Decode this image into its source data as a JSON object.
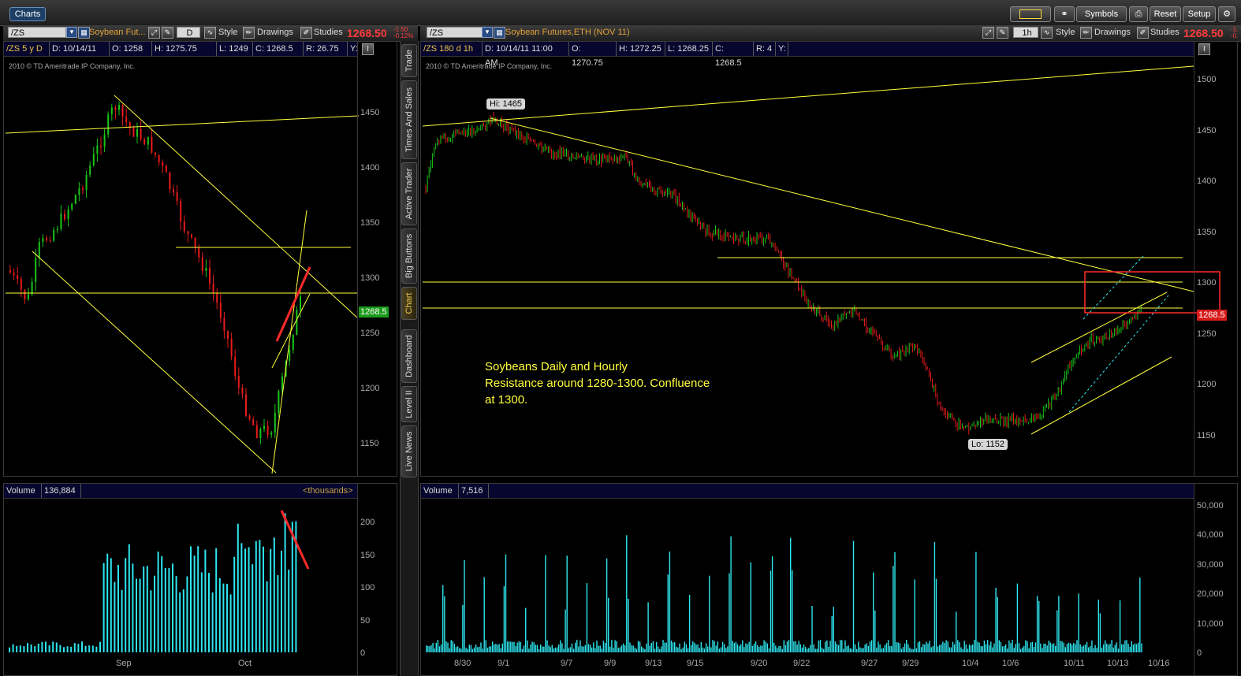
{
  "topbar": {
    "tab": "Charts",
    "symbols_label": "Symbols",
    "reset_label": "Reset",
    "setup_label": "Setup"
  },
  "left_chart": {
    "symbol": "/ZS",
    "description": "Soybean Fut...",
    "interval": "D",
    "style_label": "Style",
    "drawings_label": "Drawings",
    "studies_label": "Studies",
    "last_price": "1268.50",
    "change": "-1.50",
    "change_pct": "-0.12%",
    "info": {
      "title": "/ZS 5 y D",
      "date": "D: 10/14/11",
      "open": "O: 1258",
      "high": "H: 1275.75",
      "low": "L: 1249",
      "close": "C: 1268.5",
      "range": "R: 26.75",
      "y": "Y:"
    },
    "copyright": "2010 © TD Ameritrade IP Company, Inc.",
    "price_axis": [
      "1450",
      "1400",
      "1350",
      "1300",
      "1250",
      "1200",
      "1150"
    ],
    "current_price_tag": "1268.5",
    "volume_label": "Volume",
    "volume_value": "136,884",
    "volume_units": "<thousands>",
    "volume_axis": [
      "200",
      "150",
      "100",
      "50",
      "0"
    ],
    "date_axis": [
      "Sep",
      "Oct"
    ]
  },
  "right_chart": {
    "symbol": "/ZS",
    "description": "Soybean Futures,ETH (NOV 11)",
    "interval": "1h",
    "style_label": "Style",
    "drawings_label": "Drawings",
    "studies_label": "Studies",
    "last_price": "1268.50",
    "change": "-1.",
    "change_pct": "-0.",
    "info": {
      "title": "/ZS 180 d 1h",
      "date": "D: 10/14/11 11:00 AM",
      "open": "O: 1270.75",
      "high": "H: 1272.25",
      "low": "L: 1268.25",
      "close": "C: 1268.5",
      "range": "R: 4",
      "y": "Y:"
    },
    "copyright": "2010 © TD Ameritrade IP Company, Inc.",
    "price_axis": [
      "1500",
      "1450",
      "1400",
      "1350",
      "1300",
      "1250",
      "1200",
      "1150"
    ],
    "current_price_tag": "1268.5",
    "high_callout": "Hi: 1465",
    "low_callout": "Lo: 1152",
    "annotation": [
      "Soybeans Daily and Hourly",
      "Resistance around 1280-1300. Confluence",
      "at 1300."
    ],
    "volume_label": "Volume",
    "volume_value": "7,516",
    "volume_axis": [
      "50,000",
      "40,000",
      "30,000",
      "20,000",
      "10,000",
      "0"
    ],
    "date_axis": [
      "8/30",
      "9/1",
      "9/7",
      "9/9",
      "9/13",
      "9/15",
      "9/20",
      "9/22",
      "9/27",
      "9/29",
      "10/4",
      "10/6",
      "10/11",
      "10/13",
      "10/16"
    ]
  },
  "sidebar_tabs": [
    "Trade",
    "Times And Sales",
    "Active Trader",
    "Big Buttons",
    "Chart",
    "Dashboard",
    "Level II",
    "Live News"
  ],
  "colors": {
    "up_candle": "#19c819",
    "down_candle": "#e81a1a",
    "trendline": "#ffff3c",
    "volume_bar": "#2ee6f0",
    "highlight_box": "#ff2a2a"
  }
}
